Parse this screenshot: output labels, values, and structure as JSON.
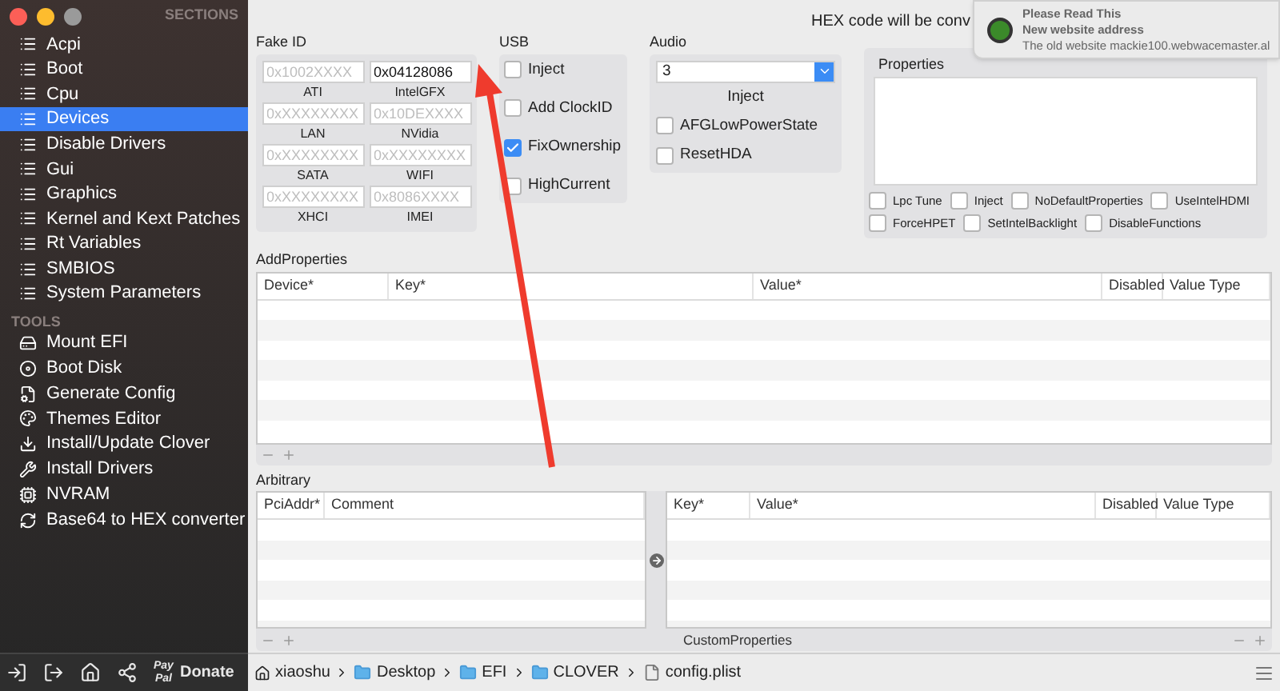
{
  "sidebar": {
    "header": "SECTIONS",
    "sections": [
      {
        "label": "Acpi",
        "selected": false
      },
      {
        "label": "Boot",
        "selected": false
      },
      {
        "label": "Cpu",
        "selected": false
      },
      {
        "label": "Devices",
        "selected": true
      },
      {
        "label": "Disable Drivers",
        "selected": false
      },
      {
        "label": "Gui",
        "selected": false
      },
      {
        "label": "Graphics",
        "selected": false
      },
      {
        "label": "Kernel and Kext Patches",
        "selected": false
      },
      {
        "label": "Rt Variables",
        "selected": false
      },
      {
        "label": "SMBIOS",
        "selected": false
      },
      {
        "label": "System Parameters",
        "selected": false
      }
    ],
    "tools_header": "TOOLS",
    "tools": [
      {
        "label": "Mount EFI",
        "kind": "disk"
      },
      {
        "label": "Boot Disk",
        "kind": "drive"
      },
      {
        "label": "Generate Config",
        "kind": "config"
      },
      {
        "label": "Themes Editor",
        "kind": "theme"
      },
      {
        "label": "Install/Update Clover",
        "kind": "install"
      },
      {
        "label": "Install Drivers",
        "kind": "wrench"
      },
      {
        "label": "NVRAM",
        "kind": "chip"
      },
      {
        "label": "Base64 to HEX converter",
        "kind": "convert"
      }
    ],
    "footer": {
      "paypal_top": "Pay",
      "paypal_bottom": "Pal",
      "donate": "Donate"
    }
  },
  "header_text": "HEX code will be conv",
  "notification": {
    "title": "Please Read This",
    "subtitle": "New website address",
    "body": "The old website mackie100.webwacemaster.al"
  },
  "fake_id": {
    "title": "Fake ID",
    "fields": [
      {
        "label": "ATI",
        "placeholder": "0x1002XXXX"
      },
      {
        "label": "IntelGFX",
        "value": "0x04128086"
      },
      {
        "label": "LAN",
        "placeholder": "0xXXXXXXXX"
      },
      {
        "label": "NVidia",
        "placeholder": "0x10DEXXXX"
      },
      {
        "label": "SATA",
        "placeholder": "0xXXXXXXXX"
      },
      {
        "label": "WIFI",
        "placeholder": "0xXXXXXXXX"
      },
      {
        "label": "XHCI",
        "placeholder": "0xXXXXXXXX"
      },
      {
        "label": "IMEI",
        "placeholder": "0x8086XXXX"
      }
    ]
  },
  "usb": {
    "title": "USB",
    "options": [
      {
        "label": "Inject",
        "checked": false
      },
      {
        "label": "Add ClockID",
        "checked": false
      },
      {
        "label": "FixOwnership",
        "checked": true
      },
      {
        "label": "HighCurrent",
        "checked": false
      }
    ]
  },
  "audio": {
    "title": "Audio",
    "value": "3",
    "inject_label": "Inject",
    "options": [
      {
        "label": "AFGLowPowerState",
        "checked": false
      },
      {
        "label": "ResetHDA",
        "checked": false
      }
    ]
  },
  "properties": {
    "title": "Properties",
    "options": [
      {
        "label": "Lpc Tune",
        "checked": false
      },
      {
        "label": "Inject",
        "checked": false
      },
      {
        "label": "NoDefaultProperties",
        "checked": false
      },
      {
        "label": "UseIntelHDMI",
        "checked": false
      },
      {
        "label": "ForceHPET",
        "checked": false
      },
      {
        "label": "SetIntelBacklight",
        "checked": false
      },
      {
        "label": "DisableFunctions",
        "checked": false
      }
    ]
  },
  "add_properties": {
    "title": "AddProperties",
    "columns": [
      "Device*",
      "Key*",
      "Value*",
      "Disabled",
      "Value Type"
    ]
  },
  "arbitrary": {
    "title": "Arbitrary",
    "left_columns": [
      "PciAddr*",
      "Comment"
    ],
    "right_columns": [
      "Key*",
      "Value*",
      "Disabled",
      "Value Type"
    ],
    "custom_label": "CustomProperties"
  },
  "path_bar": [
    {
      "label": "xiaoshu",
      "kind": "home"
    },
    {
      "label": "Desktop",
      "kind": "folder"
    },
    {
      "label": "EFI",
      "kind": "folder"
    },
    {
      "label": "CLOVER",
      "kind": "folder"
    },
    {
      "label": "config.plist",
      "kind": "file"
    }
  ]
}
